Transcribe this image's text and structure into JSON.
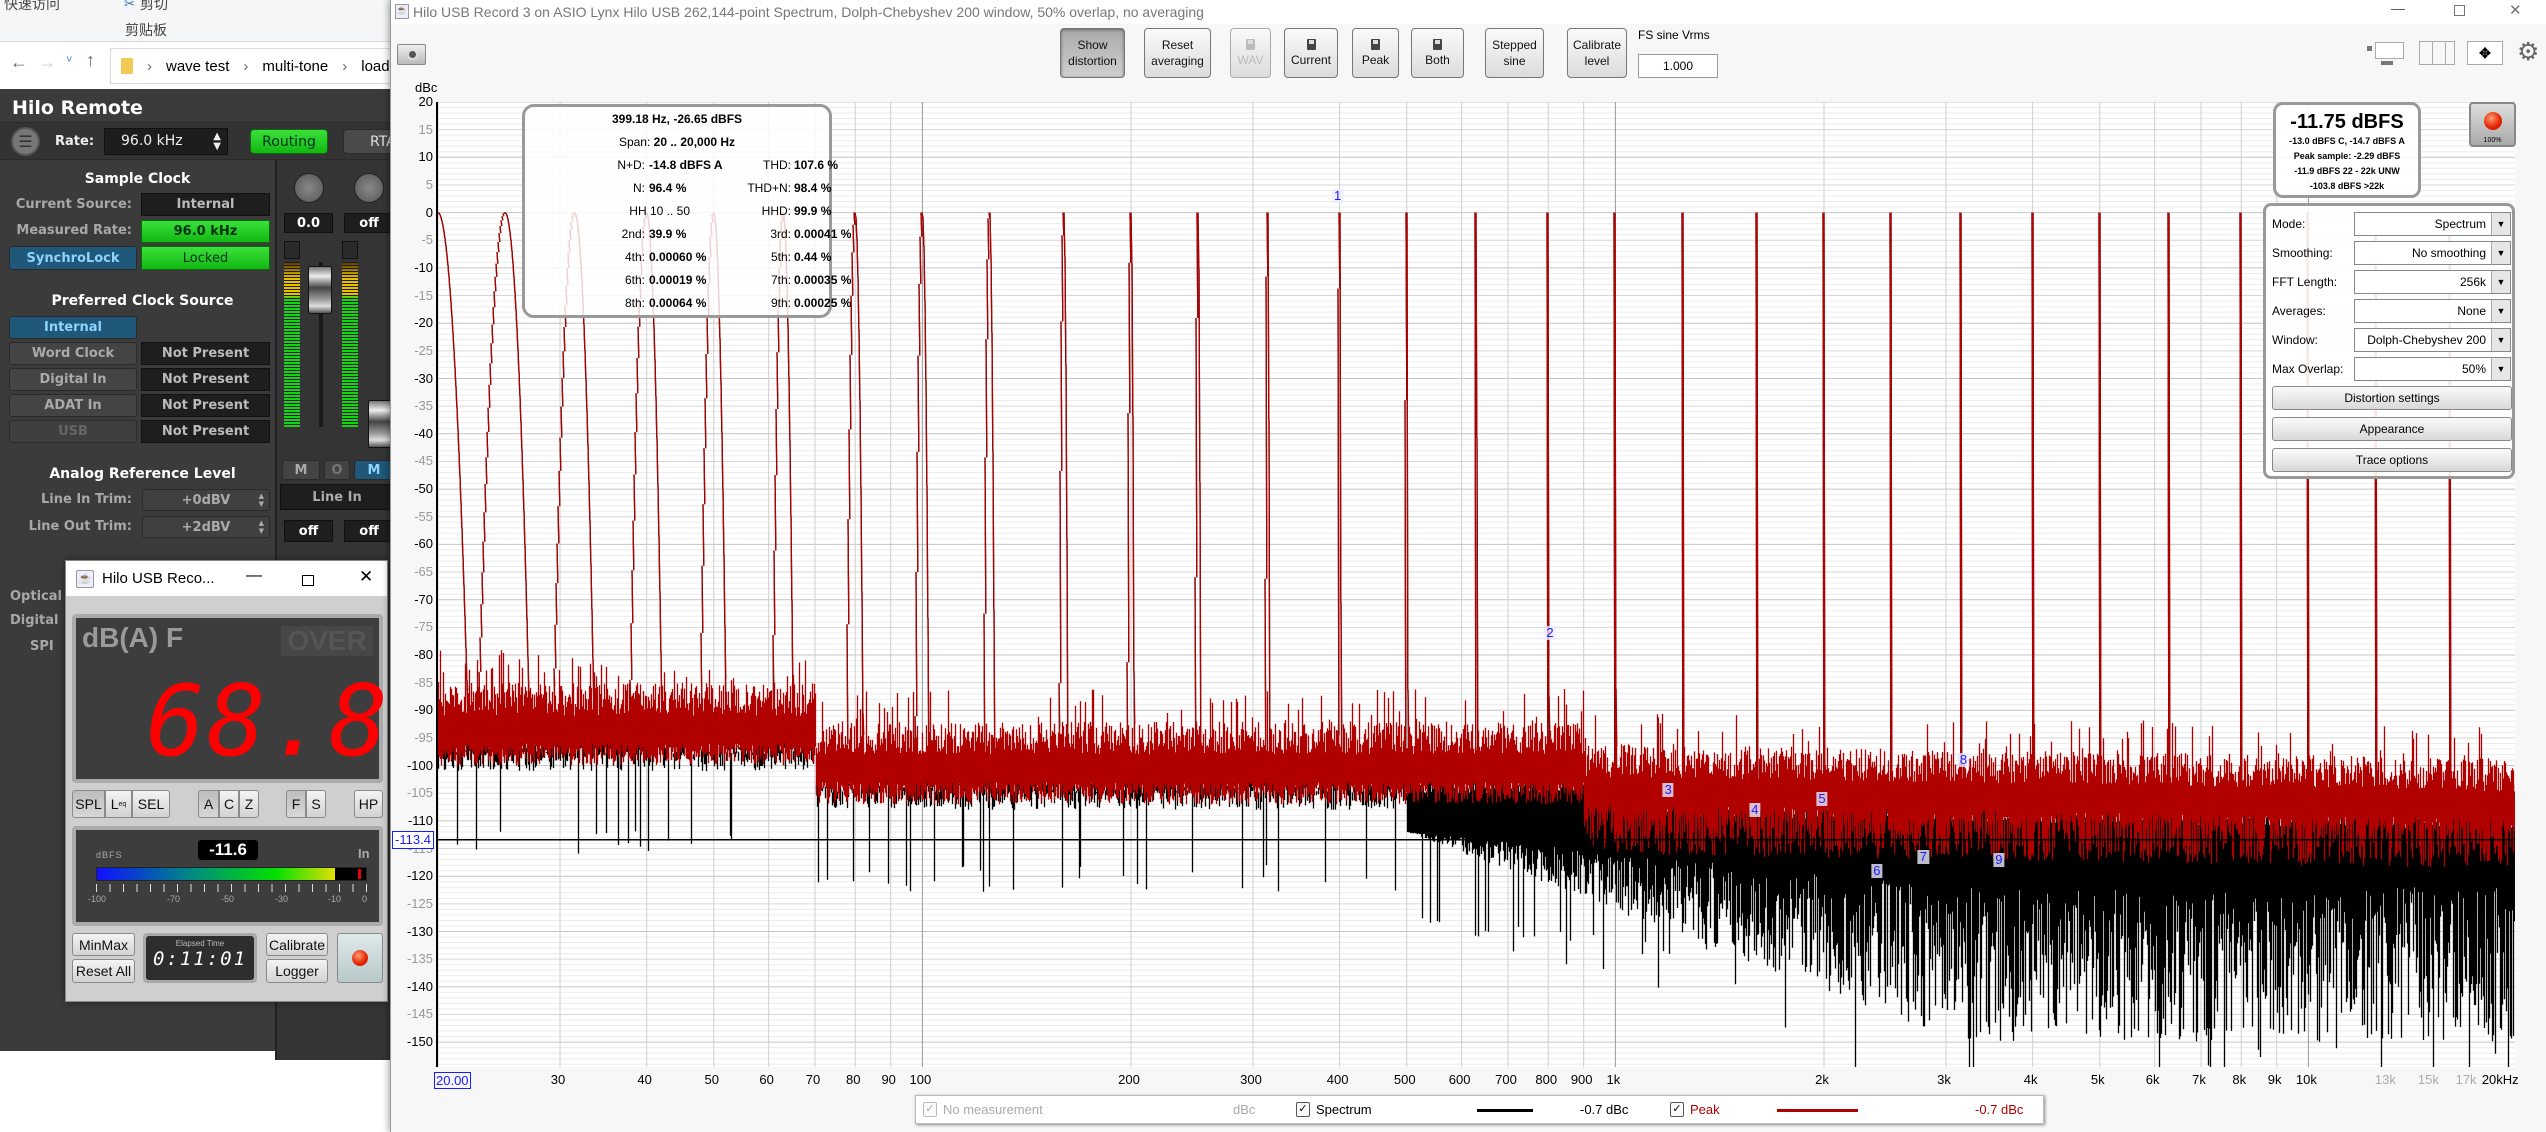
{
  "explorer": {
    "ribbon_top": "快速访问",
    "cut": "剪切",
    "clipboard": "剪贴板",
    "breadcrumb": [
      "wave test",
      "multi-tone",
      "load"
    ]
  },
  "hilo_remote": {
    "title": "Hilo Remote",
    "rate_label": "Rate:",
    "rate_value": "96.0 kHz",
    "routing": "Routing",
    "rta": "RTA",
    "sample_clock": {
      "heading": "Sample Clock",
      "current_source_label": "Current Source:",
      "current_source": "Internal",
      "measured_rate_label": "Measured Rate:",
      "measured_rate": "96.0 kHz",
      "synchrolock": "SynchroLock",
      "locked": "Locked"
    },
    "preferred_clock": {
      "heading": "Preferred Clock Source",
      "items": [
        {
          "label": "Internal",
          "status": ""
        },
        {
          "label": "Word Clock",
          "status": "Not Present"
        },
        {
          "label": "Digital In",
          "status": "Not Present"
        },
        {
          "label": "ADAT In",
          "status": "Not Present"
        },
        {
          "label": "USB",
          "status": "Not Present"
        }
      ]
    },
    "analog_ref": {
      "heading": "Analog Reference Level",
      "line_in_label": "Line In Trim:",
      "line_in": "+0dBV",
      "line_out_label": "Line Out Trim:",
      "line_out": "+2dBV"
    },
    "lower_labels": [
      "Optical",
      "Digital",
      "SPI"
    ],
    "mixer": {
      "pan1": "0.0",
      "pan2": "off",
      "mute": "M",
      "solo": "O",
      "mute2": "M",
      "input": "Line In",
      "out1": "off",
      "out2": "off"
    }
  },
  "spl_meter": {
    "title": "Hilo USB Reco...",
    "weighting": "dB(A) F",
    "over": "OVER",
    "reading": "68.8",
    "mode_buttons": [
      "SPL",
      "L",
      "SEL"
    ],
    "leq_sub": "eq",
    "weight_buttons": [
      "A",
      "C",
      "Z"
    ],
    "time_buttons": [
      "F",
      "S"
    ],
    "hp": "HP",
    "bar_unit": "dBFS",
    "bar_value": "-11.6",
    "bar_level_dbfs": -11.6,
    "bar_channel": "In",
    "bar_ticks": [
      "-100",
      "-70",
      "-50",
      "-30",
      "-10",
      "0"
    ],
    "minmax": "MinMax",
    "reset_all": "Reset All",
    "elapsed_label": "Elapsed Time",
    "elapsed": "0:11:01",
    "calibrate": "Calibrate",
    "logger": "Logger"
  },
  "main": {
    "title": "Hilo USB Record 3 on ASIO Lynx Hilo USB 262,144-point Spectrum, Dolph-Chebyshev 200 window, 50% overlap, no averaging",
    "toolbar": {
      "show_distortion": [
        "Show",
        "distortion"
      ],
      "reset_averaging": [
        "Reset",
        "averaging"
      ],
      "wav": "WAV",
      "current": "Current",
      "peak": "Peak",
      "both": "Both",
      "stepped_sine": [
        "Stepped",
        "sine"
      ],
      "calibrate_level": [
        "Calibrate",
        "level"
      ],
      "fs_label": "FS sine Vrms",
      "fs_value": "1.000"
    },
    "info": {
      "cursor": "399.18 Hz, -26.65 dBFS",
      "span_label": "Span:",
      "span": "20 .. 20,000 Hz",
      "rows": [
        {
          "l1": "N+D:",
          "v1": "-14.8 dBFS A",
          "l2": "THD:",
          "v2": "107.6 %"
        },
        {
          "l1": "N:",
          "v1": "96.4 %",
          "l2": "THD+N:",
          "v2": "98.4 %"
        },
        {
          "l1": "HH 10 .. 50",
          "v1": "",
          "l2": "HHD:",
          "v2": "99.9 %"
        },
        {
          "l1": "2nd:",
          "v1": "39.9 %",
          "l2": "3rd:",
          "v2": "0.00041 %"
        },
        {
          "l1": "4th:",
          "v1": "0.00060 %",
          "l2": "5th:",
          "v2": "0.44 %"
        },
        {
          "l1": "6th:",
          "v1": "0.00019 %",
          "l2": "7th:",
          "v2": "0.00035 %"
        },
        {
          "l1": "8th:",
          "v1": "0.00064 %",
          "l2": "9th:",
          "v2": "0.00025 %"
        }
      ]
    },
    "level": {
      "main": "-11.75 dBFS",
      "lines": [
        "-13.0 dBFS C, -14.7 dBFS A",
        "Peak sample: -2.29 dBFS",
        "-11.9 dBFS 22 - 22k UNW",
        "-103.8 dBFS >22k"
      ],
      "record_pct": "100%"
    },
    "settings": {
      "rows": [
        {
          "label": "Mode:",
          "value": "Spectrum"
        },
        {
          "label": "Smoothing:",
          "value": "No  smoothing"
        },
        {
          "label": "FFT Length:",
          "value": "256k"
        },
        {
          "label": "Averages:",
          "value": "None"
        },
        {
          "label": "Window:",
          "value": "Dolph-Chebyshev 200"
        },
        {
          "label": "Max Overlap:",
          "value": "50%"
        }
      ],
      "distortion_settings": "Distortion settings",
      "appearance": "Appearance",
      "trace_options": "Trace options"
    },
    "legend": {
      "no_measurement": "No measurement",
      "unit": "dBc",
      "spectrum": "Spectrum",
      "spectrum_value": "-0.7 dBc",
      "peak": "Peak",
      "peak_value": "-0.7 dBc",
      "spectrum_color": "#000000",
      "peak_color": "#b00000"
    }
  },
  "chart_data": {
    "type": "line",
    "ylabel": "dBc",
    "xunit": "Hz",
    "xscale": "log",
    "xlim": [
      20,
      20000
    ],
    "ylim": [
      -154.5,
      20
    ],
    "grid": true,
    "y_ticks": [
      20,
      15,
      10,
      5,
      0,
      -5,
      -10,
      -15,
      -20,
      -25,
      -30,
      -35,
      -40,
      -45,
      -50,
      -55,
      -60,
      -65,
      -70,
      -75,
      -80,
      -85,
      -90,
      -95,
      -100,
      -105,
      -110,
      -115,
      -120,
      -125,
      -130,
      -135,
      -140,
      -145,
      -150
    ],
    "x_ticks": [
      {
        "f": 20,
        "label": "20.00"
      },
      {
        "f": 30,
        "label": "30"
      },
      {
        "f": 40,
        "label": "40"
      },
      {
        "f": 50,
        "label": "50"
      },
      {
        "f": 60,
        "label": "60"
      },
      {
        "f": 70,
        "label": "70"
      },
      {
        "f": 80,
        "label": "80"
      },
      {
        "f": 90,
        "label": "90"
      },
      {
        "f": 100,
        "label": "100"
      },
      {
        "f": 200,
        "label": "200"
      },
      {
        "f": 300,
        "label": "300"
      },
      {
        "f": 400,
        "label": "400"
      },
      {
        "f": 500,
        "label": "500"
      },
      {
        "f": 600,
        "label": "600"
      },
      {
        "f": 700,
        "label": "700"
      },
      {
        "f": 800,
        "label": "800"
      },
      {
        "f": 900,
        "label": "900"
      },
      {
        "f": 1000,
        "label": "1k"
      },
      {
        "f": 2000,
        "label": "2k"
      },
      {
        "f": 3000,
        "label": "3k"
      },
      {
        "f": 4000,
        "label": "4k"
      },
      {
        "f": 5000,
        "label": "5k"
      },
      {
        "f": 6000,
        "label": "6k"
      },
      {
        "f": 7000,
        "label": "7k"
      },
      {
        "f": 8000,
        "label": "8k"
      },
      {
        "f": 9000,
        "label": "9k"
      },
      {
        "f": 10000,
        "label": "10k"
      },
      {
        "f": 13000,
        "label": "13k",
        "dim": true
      },
      {
        "f": 15000,
        "label": "15k",
        "dim": true
      },
      {
        "f": 17000,
        "label": "17k",
        "dim": true
      },
      {
        "f": 20000,
        "label": "20kHz"
      }
    ],
    "cursor_level": "-113.4",
    "cursor_level_db": -113.4,
    "tones_hz": [
      20,
      25,
      31.5,
      40,
      50,
      63,
      80,
      100,
      125,
      160,
      200,
      250,
      315,
      400,
      500,
      630,
      800,
      1000,
      1250,
      1600,
      2000,
      2500,
      3150,
      4000,
      5000,
      6300,
      8000,
      10000,
      12500,
      16000,
      20000
    ],
    "tone_level_db": 0,
    "harmonic_markers": [
      {
        "n": "1",
        "f": 400,
        "db": 3
      },
      {
        "n": "2",
        "f": 810,
        "db": -76
      },
      {
        "n": "3",
        "f": 1200,
        "db": -104.5
      },
      {
        "n": "4",
        "f": 1600,
        "db": -108
      },
      {
        "n": "5",
        "f": 2000,
        "db": -106
      },
      {
        "n": "6",
        "f": 2400,
        "db": -119
      },
      {
        "n": "7",
        "f": 2800,
        "db": -116.5
      },
      {
        "n": "8",
        "f": 3200,
        "db": -99
      },
      {
        "n": "9",
        "f": 3600,
        "db": -117
      }
    ],
    "series": [
      {
        "name": "Spectrum",
        "color": "#000000"
      },
      {
        "name": "Peak",
        "color": "#b00000"
      }
    ]
  }
}
